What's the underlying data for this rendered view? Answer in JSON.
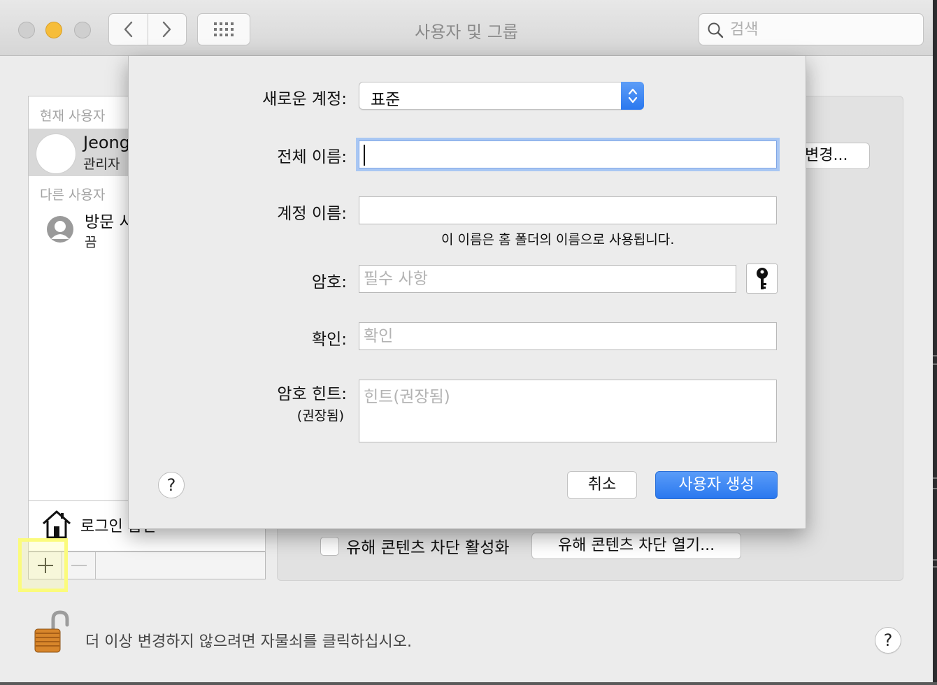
{
  "window": {
    "title": "사용자 및 그룹"
  },
  "search": {
    "placeholder": "검색"
  },
  "sidebar": {
    "current_header": "현재 사용자",
    "current_user": {
      "name": "Jeong",
      "role": "관리자"
    },
    "other_header": "다른 사용자",
    "guest_user": {
      "name": "방문 사",
      "status": "끔"
    },
    "login_options_label": "로그인 옵션"
  },
  "main": {
    "change_button": "변경...",
    "parental_controls_checkbox_label": "유해 콘텐츠 차단 활성화",
    "parental_controls_open_button": "유해 콘텐츠 차단 열기..."
  },
  "lock": {
    "text": "더 이상 변경하지 않으려면 자물쇠를 클릭하십시오."
  },
  "sheet": {
    "new_account_label": "새로운 계정:",
    "new_account_value": "표준",
    "full_name_label": "전체 이름:",
    "full_name_value": "",
    "account_name_label": "계정 이름:",
    "account_name_value": "",
    "account_name_note": "이 이름은 홈 폴더의 이름으로 사용됩니다.",
    "password_label": "암호:",
    "password_placeholder": "필수 사항",
    "verify_label": "확인:",
    "verify_placeholder": "확인",
    "hint_label": "암호 힌트:",
    "hint_sublabel": "(권장됨)",
    "hint_placeholder": "힌트(권장됨)",
    "help": "?",
    "cancel_button": "취소",
    "create_button": "사용자 생성"
  },
  "help_button": "?",
  "colors": {
    "accent": "#2a78ef",
    "highlight": "#fbfb7c",
    "traffic_min": "#f6bd3a"
  },
  "icons": [
    "back-icon",
    "forward-icon",
    "grid-icon",
    "search-icon",
    "house-icon",
    "key-icon",
    "padlock-icon",
    "guest-avatar-icon"
  ]
}
